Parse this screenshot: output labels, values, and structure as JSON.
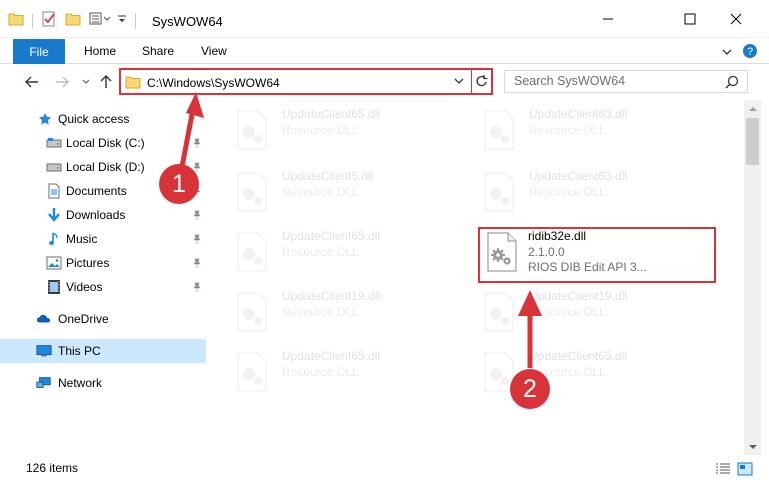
{
  "window": {
    "title": "SysWOW64",
    "controls": {
      "minimize": "minimize",
      "maximize": "maximize",
      "close": "close"
    }
  },
  "ribbon": {
    "tabs": [
      "File",
      "Home",
      "Share",
      "View"
    ]
  },
  "address": {
    "path": "C:\\Windows\\SysWOW64"
  },
  "search": {
    "placeholder": "Search SysWOW64"
  },
  "sidebar": {
    "items": [
      {
        "label": "Quick access",
        "icon": "star-icon"
      },
      {
        "label": "Local Disk (C:)",
        "icon": "drive-icon",
        "pinned": true
      },
      {
        "label": "Local Disk (D:)",
        "icon": "drive-icon",
        "pinned": true
      },
      {
        "label": "Documents",
        "icon": "documents-icon",
        "pinned": true
      },
      {
        "label": "Downloads",
        "icon": "downloads-icon",
        "pinned": true
      },
      {
        "label": "Music",
        "icon": "music-icon",
        "pinned": true
      },
      {
        "label": "Pictures",
        "icon": "pictures-icon",
        "pinned": true
      },
      {
        "label": "Videos",
        "icon": "videos-icon",
        "pinned": true
      },
      {
        "label": "OneDrive",
        "icon": "onedrive-icon"
      },
      {
        "label": "This PC",
        "icon": "this-pc-icon",
        "selected": true
      },
      {
        "label": "Network",
        "icon": "network-icon"
      }
    ]
  },
  "files": [
    {
      "name": "UpdateClient65.dll",
      "type": "Resource DLL",
      "faded": true
    },
    {
      "name": "UpdateClient63.dll",
      "type": "Resource DLL",
      "faded": true
    },
    {
      "name": "UpdateClient5.dll",
      "type": "Resource DLL",
      "faded": true
    },
    {
      "name": "UpdateClient63.dll",
      "type": "Resource DLL",
      "faded": true
    },
    {
      "name": "UpdateClient65.dll",
      "type": "Resource DLL",
      "faded": true
    },
    {
      "name": "ridib32e.dll",
      "version": "2.1.0.0",
      "description": "RIOS DIB Edit API 3...",
      "highlighted": true
    },
    {
      "name": "UpdateClient19.dll",
      "type": "Resource DLL",
      "faded": true
    },
    {
      "name": "UpdateClient19.dll",
      "type": "Resource DLL",
      "faded": true
    },
    {
      "name": "UpdateClient65.dll",
      "type": "Resource DLL",
      "faded": true
    },
    {
      "name": "UpdateClient65.dll",
      "type": "Resource DLL",
      "faded": true
    }
  ],
  "status": {
    "item_count": "126 items"
  },
  "annotations": {
    "step1": "1",
    "step2": "2",
    "color": "#d9333a"
  },
  "colors": {
    "accent": "#1979ca",
    "selected_bg": "#cce8ff",
    "annotation_red": "#d9333a"
  }
}
